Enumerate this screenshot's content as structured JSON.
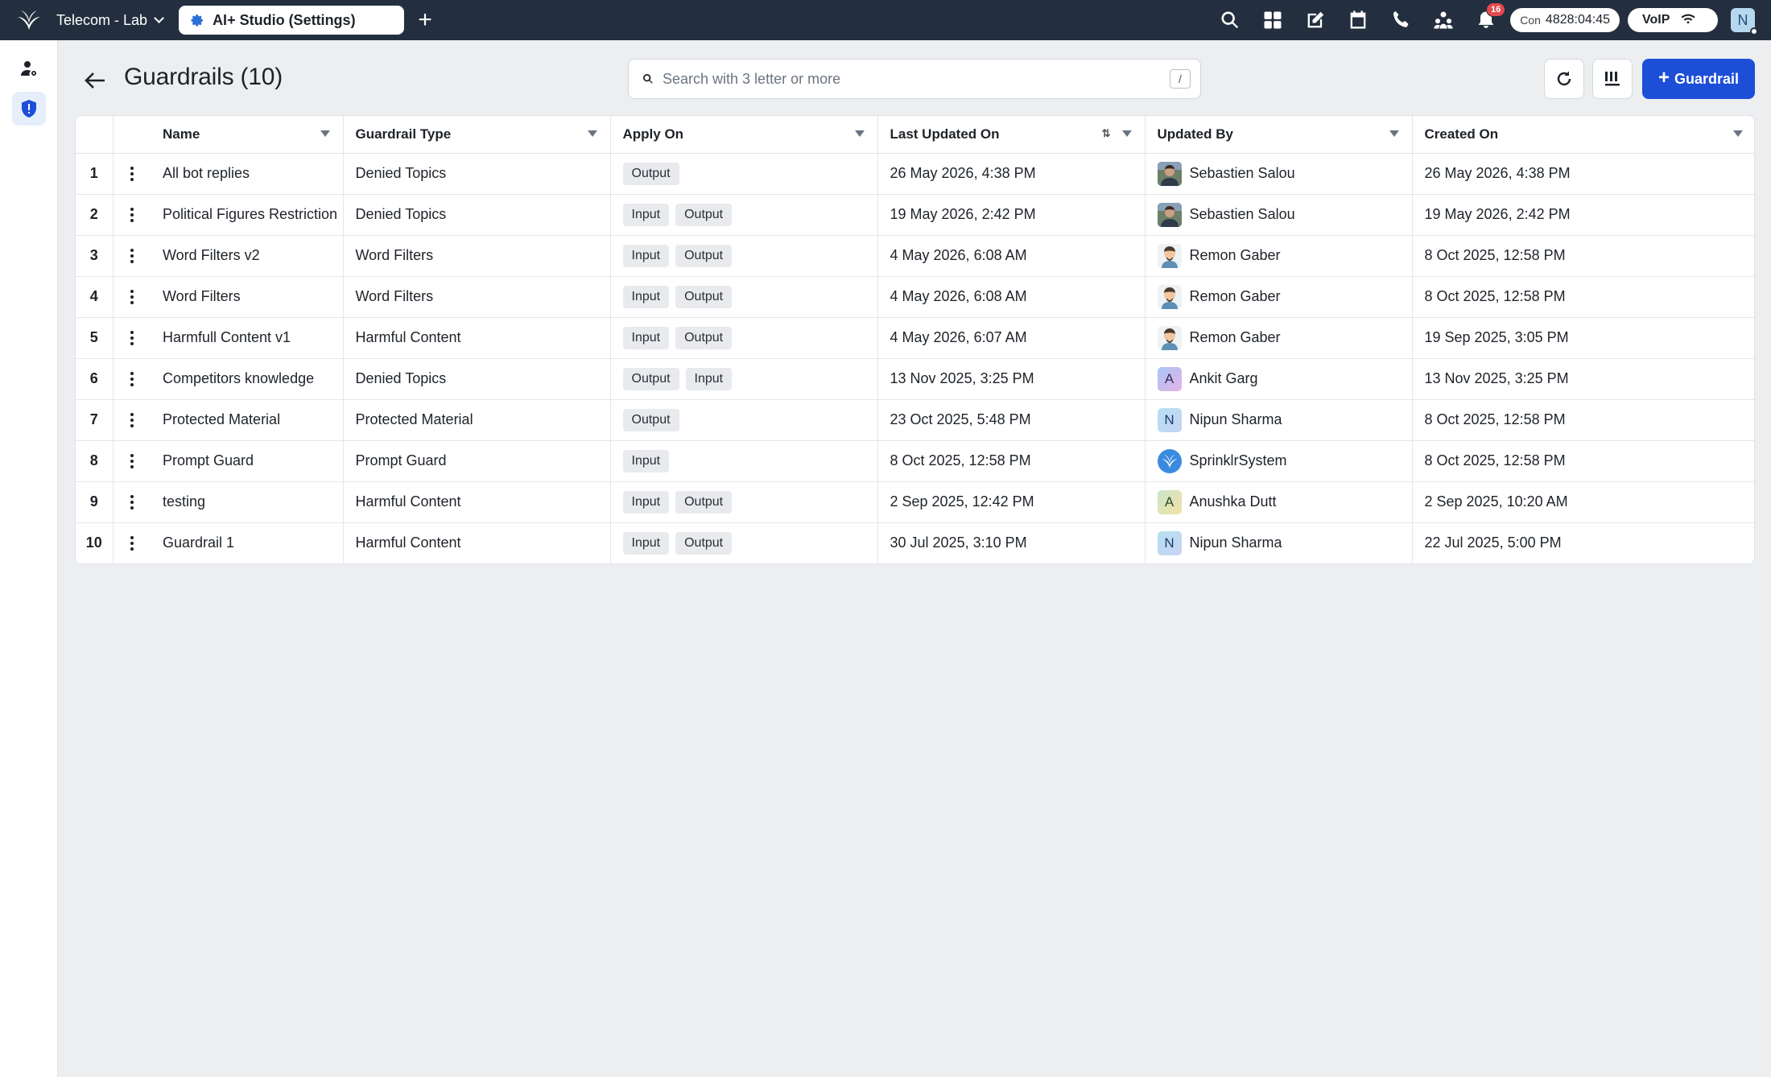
{
  "topbar": {
    "workspace": "Telecom - Lab",
    "active_tab": "AI+ Studio (Settings)",
    "notification_count": "16",
    "con_label": "Con",
    "con_timer": "4828:04:45",
    "voip_label": "VoIP",
    "user_initial": "N"
  },
  "page": {
    "title": "Guardrails (10)",
    "search_placeholder": "Search with 3 letter or more",
    "search_shortcut": "/",
    "add_button": "Guardrail"
  },
  "table": {
    "columns": [
      "Name",
      "Guardrail Type",
      "Apply On",
      "Last Updated On",
      "Updated By",
      "Created On"
    ],
    "rows": [
      {
        "index": "1",
        "name": "All bot replies",
        "type": "Denied Topics",
        "apply_on": [
          "Output"
        ],
        "last_updated": "26 May 2026, 4:38 PM",
        "updated_by": "Sebastien Salou",
        "avatar": "photo",
        "created_on": "26 May 2026, 4:38 PM"
      },
      {
        "index": "2",
        "name": "Political Figures Restriction",
        "type": "Denied Topics",
        "apply_on": [
          "Input",
          "Output"
        ],
        "last_updated": "19 May 2026, 2:42 PM",
        "updated_by": "Sebastien Salou",
        "avatar": "photo",
        "created_on": "19 May 2026, 2:42 PM"
      },
      {
        "index": "3",
        "name": "Word Filters v2",
        "type": "Word Filters",
        "apply_on": [
          "Input",
          "Output"
        ],
        "last_updated": "4 May 2026, 6:08 AM",
        "updated_by": "Remon Gaber",
        "avatar": "cartoon",
        "created_on": "8 Oct 2025, 12:58 PM"
      },
      {
        "index": "4",
        "name": "Word Filters",
        "type": "Word Filters",
        "apply_on": [
          "Input",
          "Output"
        ],
        "last_updated": "4 May 2026, 6:08 AM",
        "updated_by": "Remon Gaber",
        "avatar": "cartoon",
        "created_on": "8 Oct 2025, 12:58 PM"
      },
      {
        "index": "5",
        "name": "Harmfull Content v1",
        "type": "Harmful Content",
        "apply_on": [
          "Input",
          "Output"
        ],
        "last_updated": "4 May 2026, 6:07 AM",
        "updated_by": "Remon Gaber",
        "avatar": "cartoon",
        "created_on": "19 Sep 2025, 3:05 PM"
      },
      {
        "index": "6",
        "name": "Competitors knowledge",
        "type": "Denied Topics",
        "apply_on": [
          "Output",
          "Input"
        ],
        "last_updated": "13 Nov 2025, 3:25 PM",
        "updated_by": "Ankit Garg",
        "avatar": "A",
        "created_on": "13 Nov 2025, 3:25 PM"
      },
      {
        "index": "7",
        "name": "Protected Material",
        "type": "Protected Material",
        "apply_on": [
          "Output"
        ],
        "last_updated": "23 Oct 2025, 5:48 PM",
        "updated_by": "Nipun Sharma",
        "avatar": "N",
        "created_on": "8 Oct 2025, 12:58 PM"
      },
      {
        "index": "8",
        "name": "Prompt Guard",
        "type": "Prompt Guard",
        "apply_on": [
          "Input"
        ],
        "last_updated": "8 Oct 2025, 12:58 PM",
        "updated_by": "SprinklrSystem",
        "avatar": "logo",
        "created_on": "8 Oct 2025, 12:58 PM"
      },
      {
        "index": "9",
        "name": "testing",
        "type": "Harmful Content",
        "apply_on": [
          "Input",
          "Output"
        ],
        "last_updated": "2 Sep 2025, 12:42 PM",
        "updated_by": "Anushka Dutt",
        "avatar": "A",
        "created_on": "2 Sep 2025, 10:20 AM"
      },
      {
        "index": "10",
        "name": "Guardrail 1",
        "type": "Harmful Content",
        "apply_on": [
          "Input",
          "Output"
        ],
        "last_updated": "30 Jul 2025, 3:10 PM",
        "updated_by": "Nipun Sharma",
        "avatar": "N",
        "created_on": "22 Jul 2025, 5:00 PM"
      }
    ]
  },
  "colors": {
    "topbar_bg": "#232f3e",
    "primary": "#1d4ed8",
    "page_bg": "#eceef0"
  }
}
